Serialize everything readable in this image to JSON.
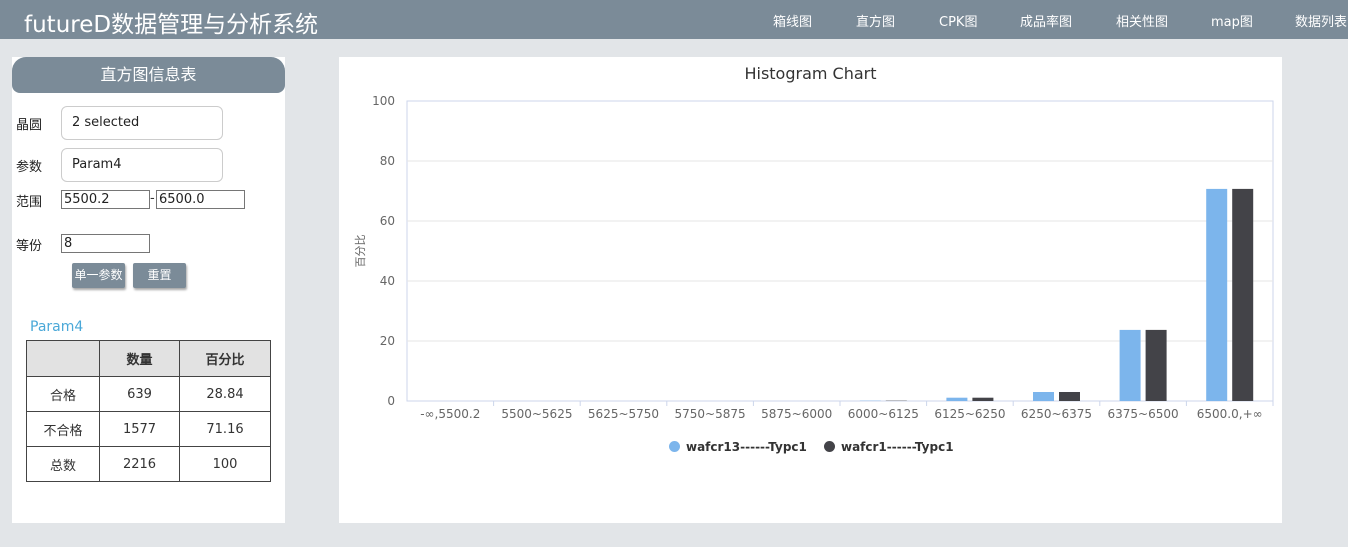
{
  "app": {
    "title": "futureD数据管理与分析系统"
  },
  "nav": [
    "箱线图",
    "直方图",
    "CPK图",
    "成品率图",
    "相关性图",
    "map图",
    "数据列表"
  ],
  "sidebar": {
    "title": "直方图信息表",
    "wafer": {
      "label": "晶圆",
      "value": "2 selected"
    },
    "param": {
      "label": "参数",
      "value": "Param4"
    },
    "range": {
      "label": "范围",
      "min": "5500.2",
      "sep": "-",
      "max": "6500.0"
    },
    "bins": {
      "label": "等份",
      "value": "8"
    },
    "buttons": {
      "single": "单一参数",
      "reset": "重置"
    },
    "table_title": "Param4",
    "table": {
      "headers": [
        "",
        "数量",
        "百分比"
      ],
      "rows": [
        [
          "合格",
          "639",
          "28.84"
        ],
        [
          "不合格",
          "1577",
          "71.16"
        ],
        [
          "总数",
          "2216",
          "100"
        ]
      ]
    }
  },
  "chart_data": {
    "type": "bar",
    "title": "Histogram Chart",
    "xlabel": "",
    "ylabel": "百分比",
    "ylim": [
      0,
      100
    ],
    "yticks": [
      0,
      20,
      40,
      60,
      80,
      100
    ],
    "grid": true,
    "legend_position": "bottom",
    "categories": [
      "-∞,5500.2",
      "5500~5625",
      "5625~5750",
      "5750~5875",
      "5875~6000",
      "6000~6125",
      "6125~6250",
      "6250~6375",
      "6375~6500",
      "6500.0,+∞"
    ],
    "series": [
      {
        "name": "wafcr13------Typc1",
        "color": "#7cb5ec",
        "values": [
          0,
          0,
          0,
          0,
          0,
          0.1,
          1.1,
          3.0,
          23.7,
          70.7
        ]
      },
      {
        "name": "wafcr1------Typc1",
        "color": "#434348",
        "values": [
          0,
          0,
          0,
          0,
          0,
          0.1,
          1.1,
          3.0,
          23.7,
          70.7
        ]
      }
    ]
  }
}
